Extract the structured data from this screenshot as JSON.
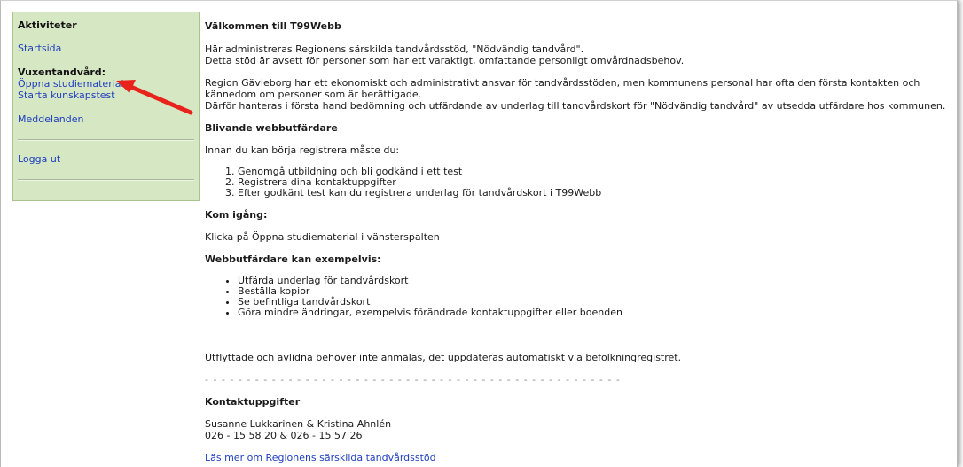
{
  "sidebar": {
    "heading": "Aktiviteter",
    "start_link": "Startsida",
    "section_title": "Vuxentandvård:",
    "study_link": "Öppna studiematerial",
    "test_link": "Starta kunskapstest",
    "messages_link": "Meddelanden",
    "logout_link": "Logga ut",
    "background_color": "#d6e7c4"
  },
  "annotation": {
    "arrow_color": "#e8231b"
  },
  "main": {
    "title": "Välkommen till T99Webb",
    "intro_line1": "Här administreras  Regionens särskilda tandvårdsstöd, \"Nödvändig tandvård\".",
    "intro_line2": "Detta stöd är avsett för personer som har ett varaktigt, omfattande personligt omvårdnadsbehov.",
    "region_line1": "Region Gävleborg har ett ekonomiskt och administrativt ansvar för tandvårdsstöden, men kommunens personal har ofta den första kontakten och kännedom om personer som är berättigade.",
    "region_line2": "Därför hanteras i första hand bedömning och utfärdande av underlag till tandvårdskort för \"Nödvändig tandvård\" av utsedda utfärdare hos kommunen.",
    "become_heading": "Blivande webbutfärdare",
    "become_intro": "Innan du kan börja registrera måste du:",
    "steps": [
      "Genomgå utbildning och bli godkänd i ett test",
      "Registrera dina kontaktuppgifter",
      "Efter godkänt test kan du registrera underlag för tandvårdskort i T99Webb"
    ],
    "start_heading": "Kom igång:",
    "start_text": "Klicka på Öppna studiematerial i vänsterspalten",
    "can_heading": "Webbutfärdare kan exempelvis:",
    "can_items": [
      "Utfärda underlag för tandvårdskort",
      "Beställa kopior",
      "Se befintliga tandvårdskort",
      "Göra mindre ändringar, exempelvis förändrade kontaktuppgifter eller boenden"
    ],
    "moved_text": "Utflyttade och avlidna behöver inte anmälas, det uppdateras automatiskt via befolkningregistret.",
    "divider": "- - - - - - - - - - - - - - - - - - - - - - - - - - - - - - - - - - - - - - - - - - - - - - - - - - - - - - - - - - - - - - - - - -",
    "contact_heading": "Kontaktuppgifter",
    "contact_names": "Susanne Lukkarinen & Kristina Ahnlén",
    "contact_phones": "026 - 15 58 20  & 026 - 15 57 26",
    "read_more_link": "Läs mer om Regionens särskilda tandvårdsstöd"
  }
}
